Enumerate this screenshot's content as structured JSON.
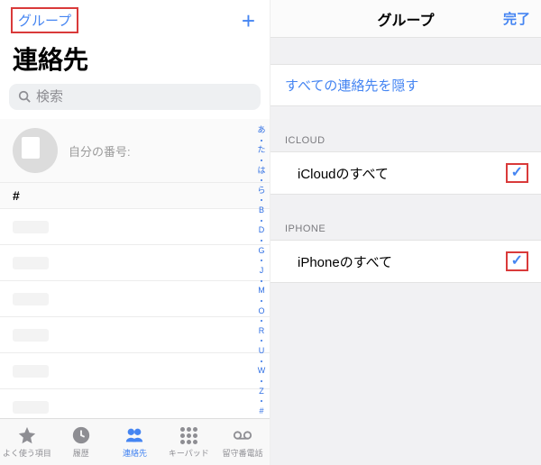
{
  "left": {
    "groups_button": "グループ",
    "add_button": "+",
    "title": "連絡先",
    "search_placeholder": "検索",
    "my_number_label": "自分の番号:",
    "section_letter": "#",
    "index_letters": [
      "あ",
      "た",
      "は",
      "ら",
      "B",
      "D",
      "G",
      "J",
      "M",
      "O",
      "R",
      "U",
      "W",
      "Z",
      "#"
    ]
  },
  "tabs": {
    "favorites": "よく使う項目",
    "recents": "履歴",
    "contacts": "連絡先",
    "keypad": "キーパッド",
    "voicemail": "留守番電話"
  },
  "right": {
    "title": "グループ",
    "done": "完了",
    "hide_all": "すべての連絡先を隠す",
    "sections": [
      {
        "header": "ICLOUD",
        "row": "iCloudのすべて",
        "checked": true
      },
      {
        "header": "IPHONE",
        "row": "iPhoneのすべて",
        "checked": true
      }
    ]
  }
}
